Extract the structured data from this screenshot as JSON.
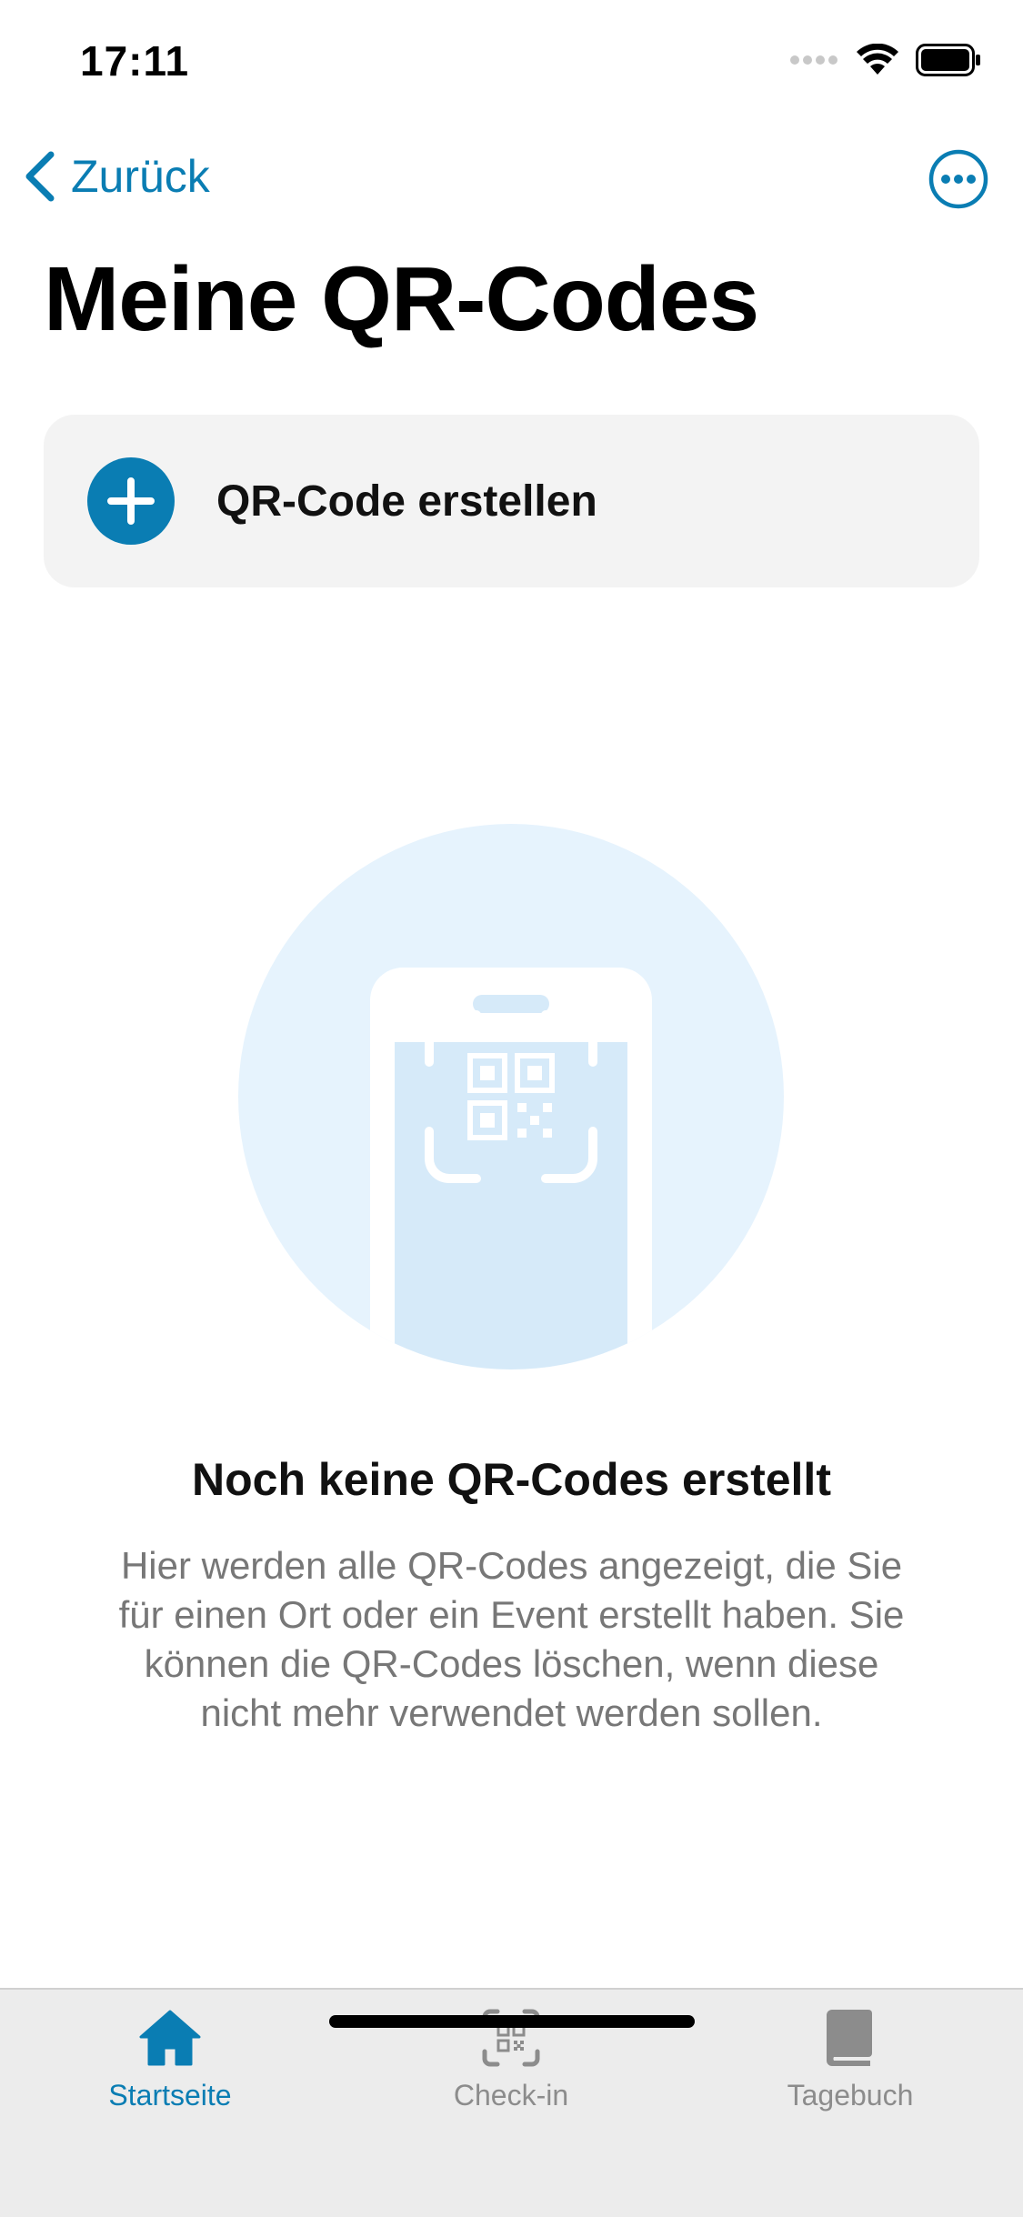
{
  "status_bar": {
    "time": "17:11"
  },
  "nav": {
    "back_label": "Zurück"
  },
  "page": {
    "title": "Meine QR-Codes"
  },
  "create_card": {
    "label": "QR-Code erstellen"
  },
  "empty_state": {
    "title": "Noch keine QR-Codes erstellt",
    "description": "Hier werden alle QR-Codes angezeigt, die Sie für einen Ort oder ein Event erstellt haben. Sie können die QR-Codes löschen, wenn diese nicht mehr verwendet werden sollen."
  },
  "tab_bar": {
    "items": [
      {
        "label": "Startseite",
        "icon": "home-icon",
        "active": true
      },
      {
        "label": "Check-in",
        "icon": "qr-scan-icon",
        "active": false
      },
      {
        "label": "Tagebuch",
        "icon": "book-icon",
        "active": false
      }
    ]
  },
  "colors": {
    "accent": "#0a7db3",
    "card_bg": "#f3f3f3",
    "illustration_bg": "#e6f3fd",
    "tab_bar_bg": "#ececec"
  }
}
